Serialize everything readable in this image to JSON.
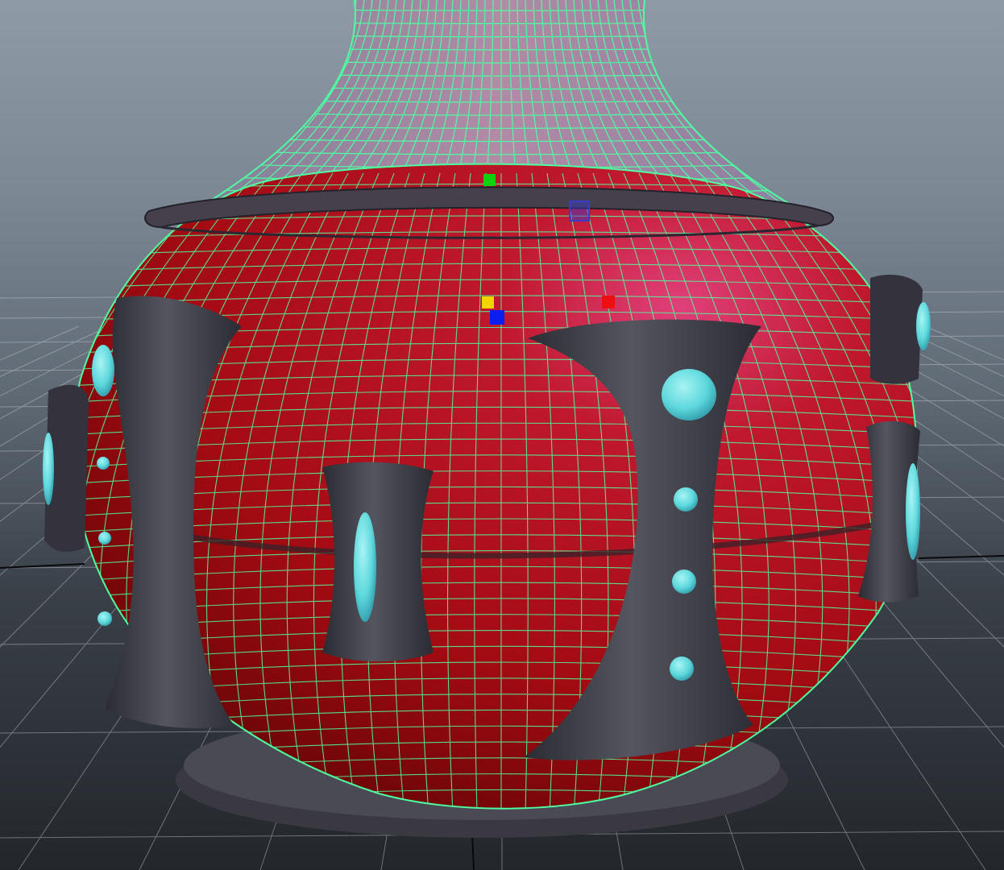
{
  "viewport": {
    "type": "3d-modeling-viewport",
    "background_colors": [
      "#8e9aa6",
      "#5f6a75",
      "#23272c"
    ],
    "grid_color": "#c9cdd2",
    "grid_axis_color": "#0a0a0a",
    "selection_wireframe_color": "#4dffa0"
  },
  "model": {
    "object": "vase",
    "body_color": "#b00e14",
    "trim_color": "#3b3b45",
    "gem_color": "#5ed8dc"
  },
  "manipulator_handles": [
    {
      "name": "green-handle",
      "color": "#10d010"
    },
    {
      "name": "outline-blue-handle",
      "color": "#3a3acc"
    },
    {
      "name": "yellow-handle",
      "color": "#f2d400"
    },
    {
      "name": "blue-handle",
      "color": "#0a1ef0"
    },
    {
      "name": "red-handle",
      "color": "#ee1010"
    }
  ]
}
